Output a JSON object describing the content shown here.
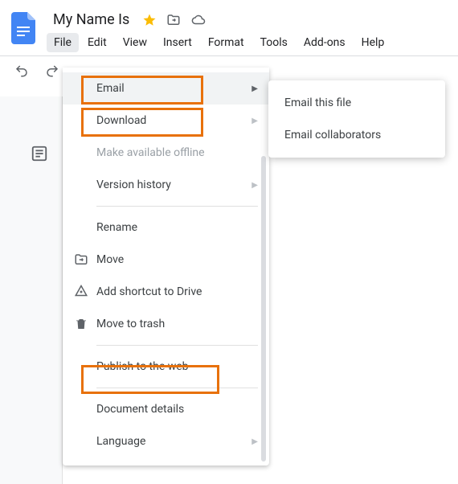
{
  "doc": {
    "title": "My Name Is"
  },
  "menubar": {
    "items": [
      "File",
      "Edit",
      "View",
      "Insert",
      "Format",
      "Tools",
      "Add-ons",
      "Help"
    ]
  },
  "file_menu": {
    "email": "Email",
    "download": "Download",
    "make_offline": "Make available offline",
    "version_history": "Version history",
    "rename": "Rename",
    "move": "Move",
    "add_shortcut": "Add shortcut to Drive",
    "move_trash": "Move to trash",
    "publish_web": "Publish to the web",
    "doc_details": "Document details",
    "language": "Language"
  },
  "email_submenu": {
    "email_file": "Email this file",
    "email_collab": "Email collaborators"
  }
}
